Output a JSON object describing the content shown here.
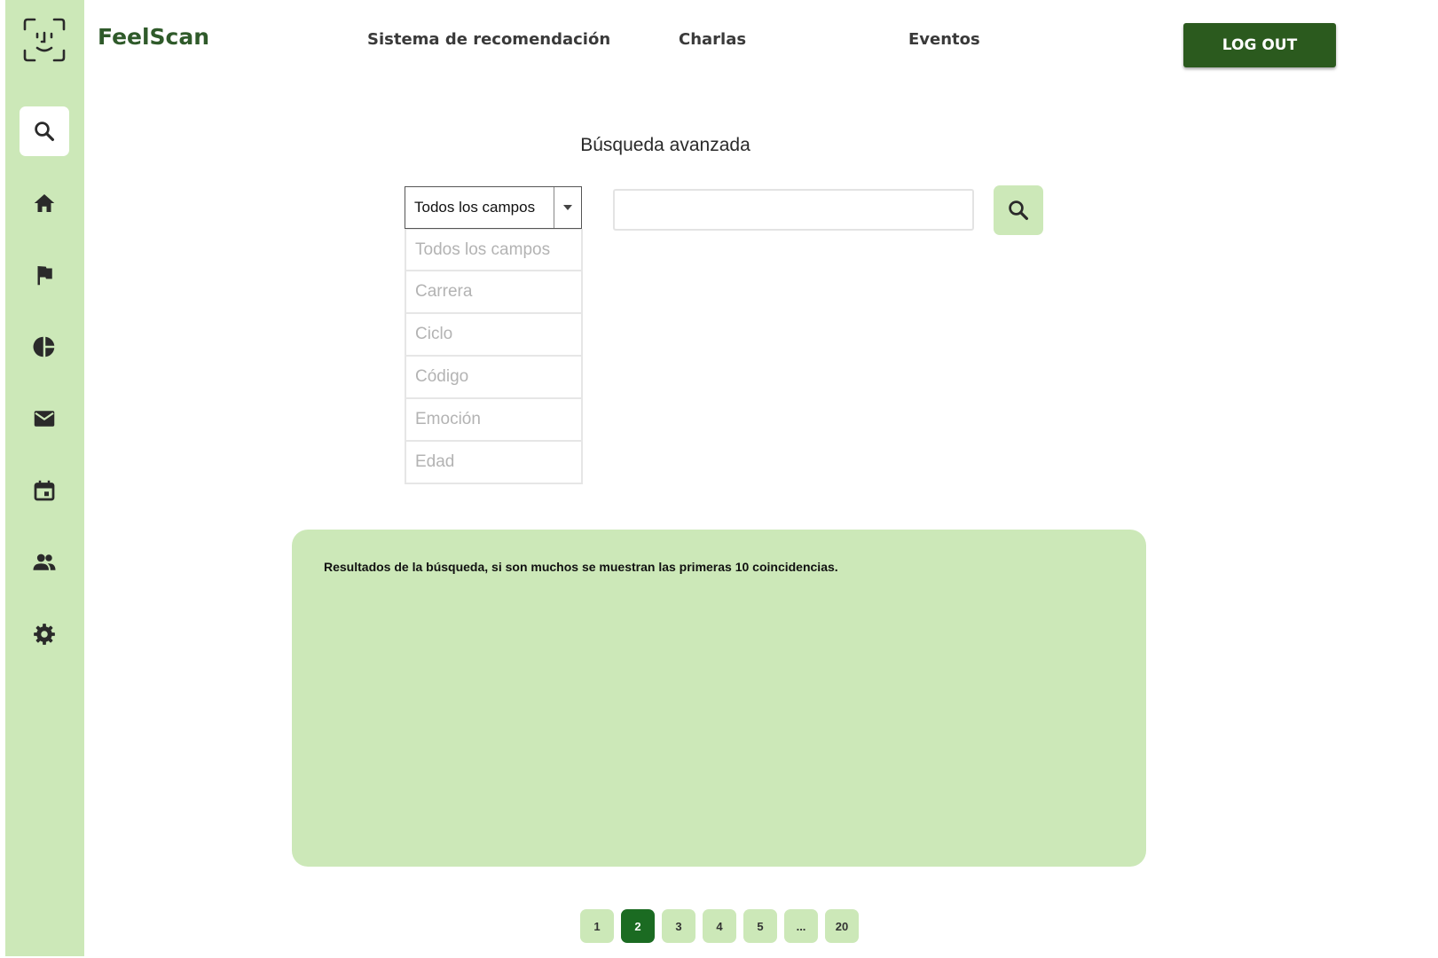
{
  "app": {
    "name": "FeelScan"
  },
  "topnav": {
    "items": [
      {
        "label": "Sistema de recomendación"
      },
      {
        "label": "Charlas"
      },
      {
        "label": "Eventos"
      }
    ],
    "logout_label": "LOG OUT"
  },
  "sidebar": {
    "items": [
      {
        "icon": "search-icon",
        "active": true
      },
      {
        "icon": "home-icon"
      },
      {
        "icon": "flag-icon"
      },
      {
        "icon": "pie-chart-icon"
      },
      {
        "icon": "mail-icon"
      },
      {
        "icon": "calendar-icon"
      },
      {
        "icon": "people-icon"
      },
      {
        "icon": "gear-icon"
      }
    ]
  },
  "search": {
    "title": "Búsqueda avanzada",
    "field_selected": "Todos los campos",
    "field_options": [
      "Todos los campos",
      "Carrera",
      "Ciclo",
      "Código",
      "Emoción",
      "Edad"
    ],
    "query_value": ""
  },
  "results": {
    "message": "Resultados de la búsqueda, si son muchos se muestran las primeras 10 coincidencias."
  },
  "pagination": {
    "pages": [
      "1",
      "2",
      "3",
      "4",
      "5",
      "...",
      "20"
    ],
    "current": "2"
  },
  "colors": {
    "accent_light": "#cce8b8",
    "accent_dark": "#2b5a1e",
    "page_current": "#1b6b22"
  }
}
